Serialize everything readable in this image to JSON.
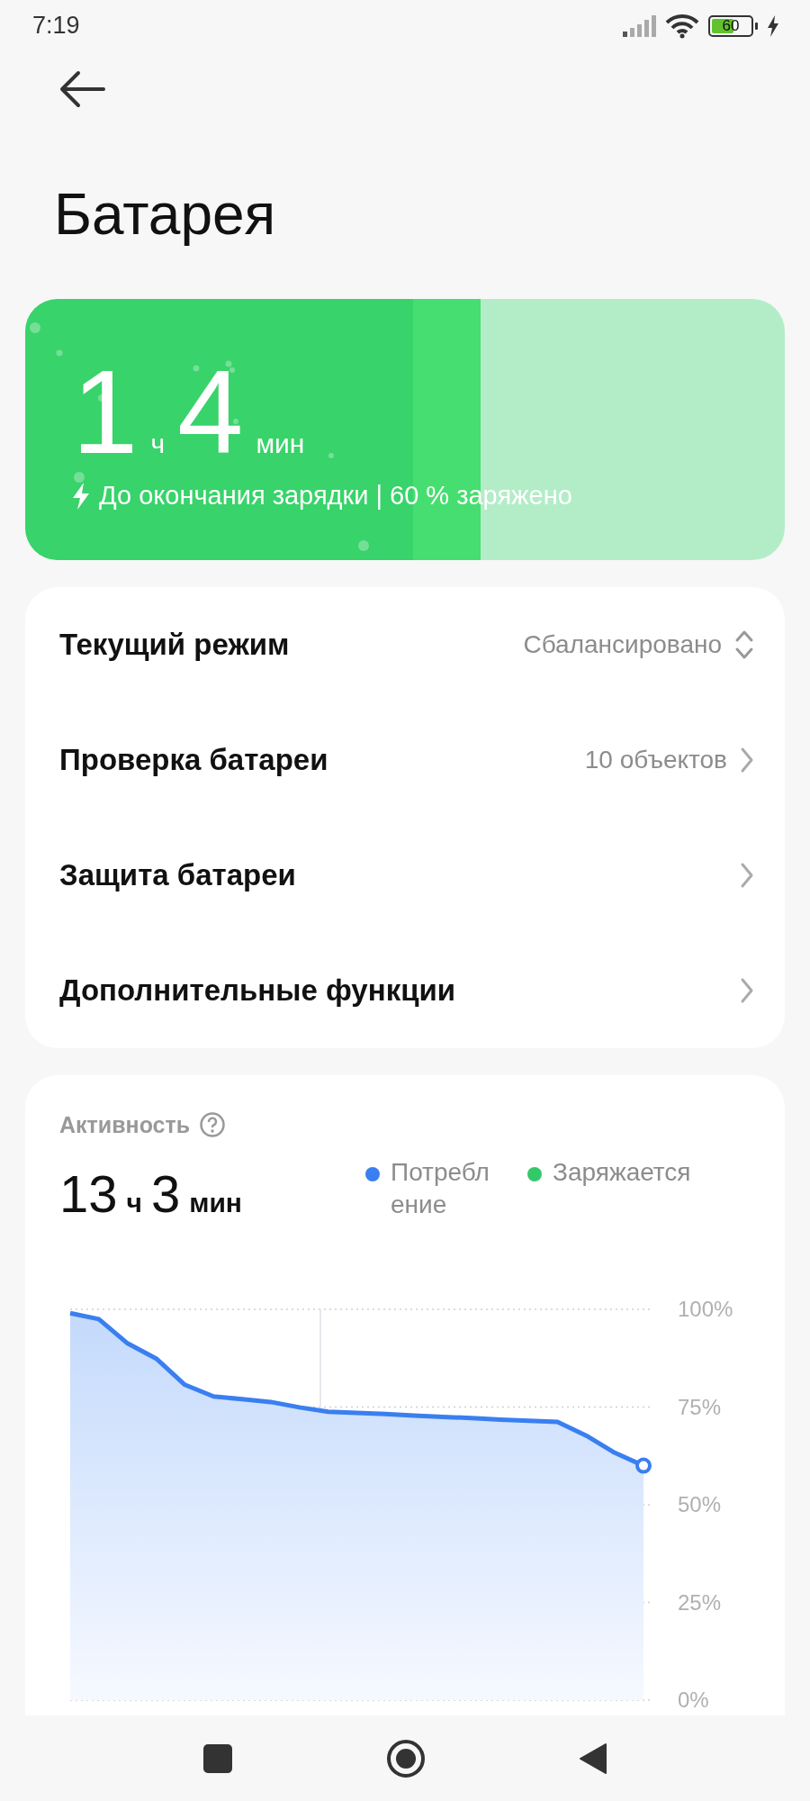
{
  "status_bar": {
    "time": "7:19",
    "battery": "60"
  },
  "header": {
    "title": "Батарея"
  },
  "charge": {
    "level": 0.6,
    "hours": "1",
    "hours_unit": "ч",
    "minutes": "4",
    "minutes_unit": "мин",
    "caption": "До окончания зарядки | 60 % заряжено"
  },
  "settings": [
    {
      "label": "Текущий режим",
      "value": "Сбалансировано",
      "kind": "select"
    },
    {
      "label": "Проверка батареи",
      "value": "10 объектов",
      "kind": "link"
    },
    {
      "label": "Защита батареи",
      "kind": "link"
    },
    {
      "label": "Дополнительные функции",
      "kind": "link"
    }
  ],
  "activity": {
    "title": "Активность",
    "hours": "13",
    "hours_unit": "ч",
    "minutes": "3",
    "minutes_unit": "мин",
    "legend": [
      {
        "label": "Потребление",
        "color": "#3a7ff0"
      },
      {
        "label": "Заряжается",
        "color": "#35c86a"
      }
    ],
    "chart_data": {
      "type": "area",
      "grid": true,
      "categories": [
        null,
        null,
        null,
        null,
        null,
        null,
        null,
        null,
        null,
        null,
        null,
        null,
        null,
        null,
        null,
        null,
        null,
        null,
        null,
        null,
        null
      ],
      "series": [
        {
          "color": "#3a7ff0",
          "values": [
            99,
            97.5,
            91.3,
            87.4,
            80.7,
            77.7,
            77,
            76.3,
            74.9,
            73.8,
            73.5,
            73.2,
            72.8,
            72.5,
            72.2,
            71.8,
            71.5,
            71.2,
            67.7,
            63.3,
            60
          ]
        }
      ],
      "ylim": [
        0,
        100
      ],
      "yticks": [
        {
          "value": 100,
          "label": "100%"
        },
        {
          "value": 75,
          "label": "75%"
        },
        {
          "value": 50,
          "label": "50%"
        },
        {
          "value": 25,
          "label": "25%"
        },
        {
          "value": 0,
          "label": "0%"
        }
      ]
    }
  }
}
